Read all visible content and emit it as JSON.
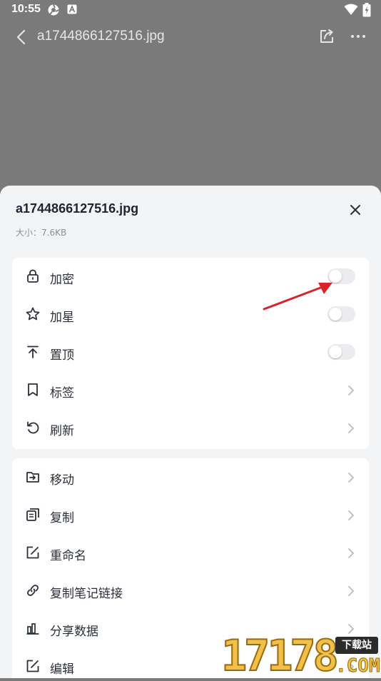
{
  "status_bar": {
    "time": "10:55"
  },
  "top_bar": {
    "file_name": "a1744866127516.jpg"
  },
  "sheet": {
    "title": "a1744866127516.jpg",
    "size_label": "大小：7.6KB",
    "group1": [
      {
        "label": "加密",
        "icon": "lock-icon",
        "control": "toggle",
        "on": false
      },
      {
        "label": "加星",
        "icon": "star-icon",
        "control": "toggle",
        "on": false
      },
      {
        "label": "置顶",
        "icon": "pin-top-icon",
        "control": "toggle",
        "on": false
      },
      {
        "label": "标签",
        "icon": "bookmark-icon",
        "control": "chevron"
      },
      {
        "label": "刷新",
        "icon": "refresh-icon",
        "control": "chevron"
      }
    ],
    "group2": [
      {
        "label": "移动",
        "icon": "move-icon",
        "control": "chevron"
      },
      {
        "label": "复制",
        "icon": "copy-icon",
        "control": "chevron"
      },
      {
        "label": "重命名",
        "icon": "rename-icon",
        "control": "chevron"
      },
      {
        "label": "复制笔记链接",
        "icon": "link-icon",
        "control": "chevron"
      },
      {
        "label": "分享数据",
        "icon": "chart-icon",
        "control": "chevron"
      },
      {
        "label": "编辑",
        "icon": "edit-icon",
        "control": "chevron"
      }
    ]
  },
  "watermark": {
    "number": "17178",
    "badge": "下载站",
    "suffix": ".COM"
  },
  "colors": {
    "overlay": "#7a7a7a",
    "sheet_bg": "#f3f4f6",
    "card_bg": "#ffffff",
    "annotation_arrow": "#d9252a"
  }
}
